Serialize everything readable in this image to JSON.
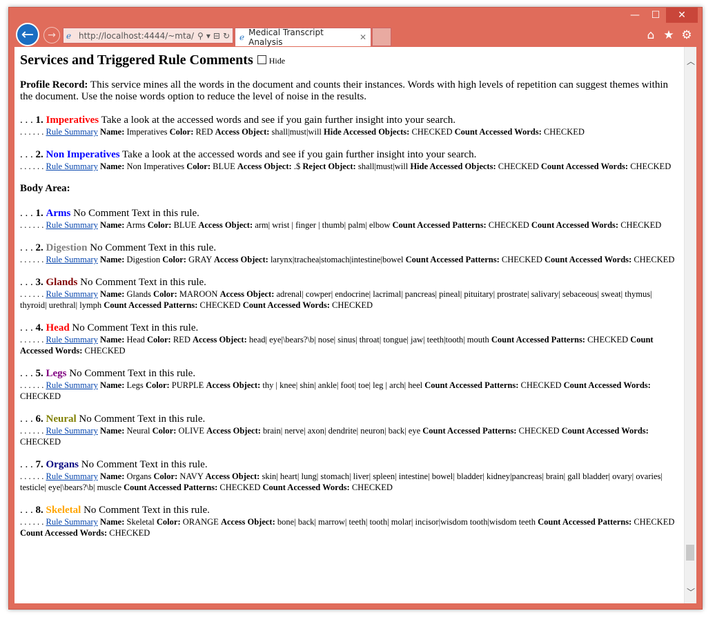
{
  "browser": {
    "address": "http://localhost:4444/~mta/",
    "tab_title": "Medical Transcript Analysis",
    "win_min": "—",
    "win_max": "☐",
    "win_close": "✕",
    "icons": [
      "back-icon",
      "forward-icon",
      "home-icon",
      "favorites-icon",
      "settings-icon"
    ]
  },
  "page": {
    "heading": "Services and Triggered Rule Comments",
    "hide_label": "Hide",
    "profile_label": "Profile Record:",
    "profile_text": " This service mines all the words in the document and counts their instances. Words with high levels of repetition can suggest themes within the document. Use the noise words option to reduce the level of noise in the results.",
    "body_area": "Body Area:",
    "rule_summary": "Rule Summary",
    "colors": {
      "red": "#ff0000",
      "blue": "#0000ff",
      "gray": "#808080",
      "maroon": "#800000",
      "purple": "#800080",
      "olive": "#808000",
      "navy": "#000080",
      "orange": "#ffa500"
    }
  },
  "profile_rules": [
    {
      "prefix": ". . . ",
      "num": "1.",
      "name": "Imperatives",
      "color": "#ff0000",
      "comment": " Take a look at the accessed words and see if you gain further insight into your search.",
      "detail_html_parts": [
        {
          "l": "Name:",
          "v": " Imperatives "
        },
        {
          "l": "Color:",
          "v": " RED "
        },
        {
          "l": "Access Object:",
          "v": " shall|must|will "
        },
        {
          "l": "Hide Accessed Objects:",
          "v": " CHECKED "
        },
        {
          "l": "Count Accessed Words:",
          "v": " CHECKED"
        }
      ]
    },
    {
      "prefix": ". . . ",
      "num": "2.",
      "name": "Non Imperatives",
      "color": "#0000ff",
      "comment": " Take a look at the accessed words and see if you gain further insight into your search.",
      "detail_html_parts": [
        {
          "l": "Name:",
          "v": " Non Imperatives "
        },
        {
          "l": "Color:",
          "v": " BLUE "
        },
        {
          "l": "Access Object:",
          "v": " .$ "
        },
        {
          "l": "Reject Object:",
          "v": " shall|must|will "
        },
        {
          "l": "Hide Accessed Objects:",
          "v": " CHECKED "
        },
        {
          "l": "Count Accessed Words:",
          "v": " CHECKED"
        }
      ]
    }
  ],
  "body_rules": [
    {
      "prefix": ". . . ",
      "num": "1.",
      "name": "Arms",
      "color": "#0000ff",
      "comment": " No Comment Text in this rule.",
      "detail_html_parts": [
        {
          "l": "Name:",
          "v": " Arms "
        },
        {
          "l": "Color:",
          "v": " BLUE "
        },
        {
          "l": "Access Object:",
          "v": " arm| wrist | finger | thumb| palm| elbow "
        },
        {
          "l": "Count Accessed Patterns:",
          "v": " CHECKED "
        },
        {
          "l": "Count Accessed Words:",
          "v": " CHECKED"
        }
      ]
    },
    {
      "prefix": ". . . ",
      "num": "2.",
      "name": "Digestion",
      "color": "#808080",
      "comment": " No Comment Text in this rule.",
      "detail_html_parts": [
        {
          "l": "Name:",
          "v": " Digestion "
        },
        {
          "l": "Color:",
          "v": " GRAY "
        },
        {
          "l": "Access Object:",
          "v": " larynx|trachea|stomach|intestine|bowel "
        },
        {
          "l": "Count Accessed Patterns:",
          "v": " CHECKED "
        },
        {
          "l": "Count Accessed Words:",
          "v": " CHECKED"
        }
      ]
    },
    {
      "prefix": ". . . ",
      "num": "3.",
      "name": "Glands",
      "color": "#800000",
      "comment": " No Comment Text in this rule.",
      "detail_html_parts": [
        {
          "l": "Name:",
          "v": " Glands "
        },
        {
          "l": "Color:",
          "v": " MAROON "
        },
        {
          "l": "Access Object:",
          "v": " adrenal| cowper| endocrine| lacrimal| pancreas| pineal| pituitary| prostrate| salivary| sebaceous| sweat| thymus| thyroid| urethral| lymph "
        },
        {
          "l": "Count Accessed Patterns:",
          "v": " CHECKED "
        },
        {
          "l": "Count Accessed Words:",
          "v": " CHECKED"
        }
      ]
    },
    {
      "prefix": ". . . ",
      "num": "4.",
      "name": "Head",
      "color": "#ff0000",
      "comment": " No Comment Text in this rule.",
      "detail_html_parts": [
        {
          "l": "Name:",
          "v": " Head "
        },
        {
          "l": "Color:",
          "v": " RED "
        },
        {
          "l": "Access Object:",
          "v": " head| eye|\\bears?\\b| nose| sinus| throat| tongue| jaw| teeth|tooth| mouth "
        },
        {
          "l": "Count Accessed Patterns:",
          "v": " CHECKED "
        },
        {
          "l": "Count Accessed Words:",
          "v": " CHECKED"
        }
      ]
    },
    {
      "prefix": ". . . ",
      "num": "5.",
      "name": "Legs",
      "color": "#800080",
      "comment": " No Comment Text in this rule.",
      "detail_html_parts": [
        {
          "l": "Name:",
          "v": " Legs "
        },
        {
          "l": "Color:",
          "v": " PURPLE "
        },
        {
          "l": "Access Object:",
          "v": " thy | knee| shin| ankle| foot| toe| leg | arch| heel "
        },
        {
          "l": "Count Accessed Patterns:",
          "v": " CHECKED "
        },
        {
          "l": "Count Accessed Words:",
          "v": " CHECKED"
        }
      ]
    },
    {
      "prefix": ". . . ",
      "num": "6.",
      "name": "Neural",
      "color": "#808000",
      "comment": " No Comment Text in this rule.",
      "detail_html_parts": [
        {
          "l": "Name:",
          "v": " Neural "
        },
        {
          "l": "Color:",
          "v": " OLIVE "
        },
        {
          "l": "Access Object:",
          "v": " brain| nerve| axon| dendrite| neuron| back| eye "
        },
        {
          "l": "Count Accessed Patterns:",
          "v": " CHECKED "
        },
        {
          "l": "Count Accessed Words:",
          "v": " CHECKED"
        }
      ]
    },
    {
      "prefix": ". . . ",
      "num": "7.",
      "name": "Organs",
      "color": "#000080",
      "comment": " No Comment Text in this rule.",
      "detail_html_parts": [
        {
          "l": "Name:",
          "v": " Organs "
        },
        {
          "l": "Color:",
          "v": " NAVY "
        },
        {
          "l": "Access Object:",
          "v": " skin| heart| lung| stomach| liver| spleen| intestine| bowel| bladder| kidney|pancreas| brain| gall bladder| ovary| ovaries| testicle| eye|\\bears?\\b| muscle "
        },
        {
          "l": "Count Accessed Patterns:",
          "v": " CHECKED "
        },
        {
          "l": "Count Accessed Words:",
          "v": " CHECKED"
        }
      ]
    },
    {
      "prefix": ". . . ",
      "num": "8.",
      "name": "Skeletal",
      "color": "#ffa500",
      "comment": " No Comment Text in this rule.",
      "detail_html_parts": [
        {
          "l": "Name:",
          "v": " Skeletal "
        },
        {
          "l": "Color:",
          "v": " ORANGE "
        },
        {
          "l": "Access Object:",
          "v": " bone| back| marrow| teeth| tooth| molar| incisor|wisdom tooth|wisdom teeth "
        },
        {
          "l": "Count Accessed Patterns:",
          "v": " CHECKED "
        },
        {
          "l": "Count Accessed Words:",
          "v": " CHECKED"
        }
      ]
    }
  ]
}
